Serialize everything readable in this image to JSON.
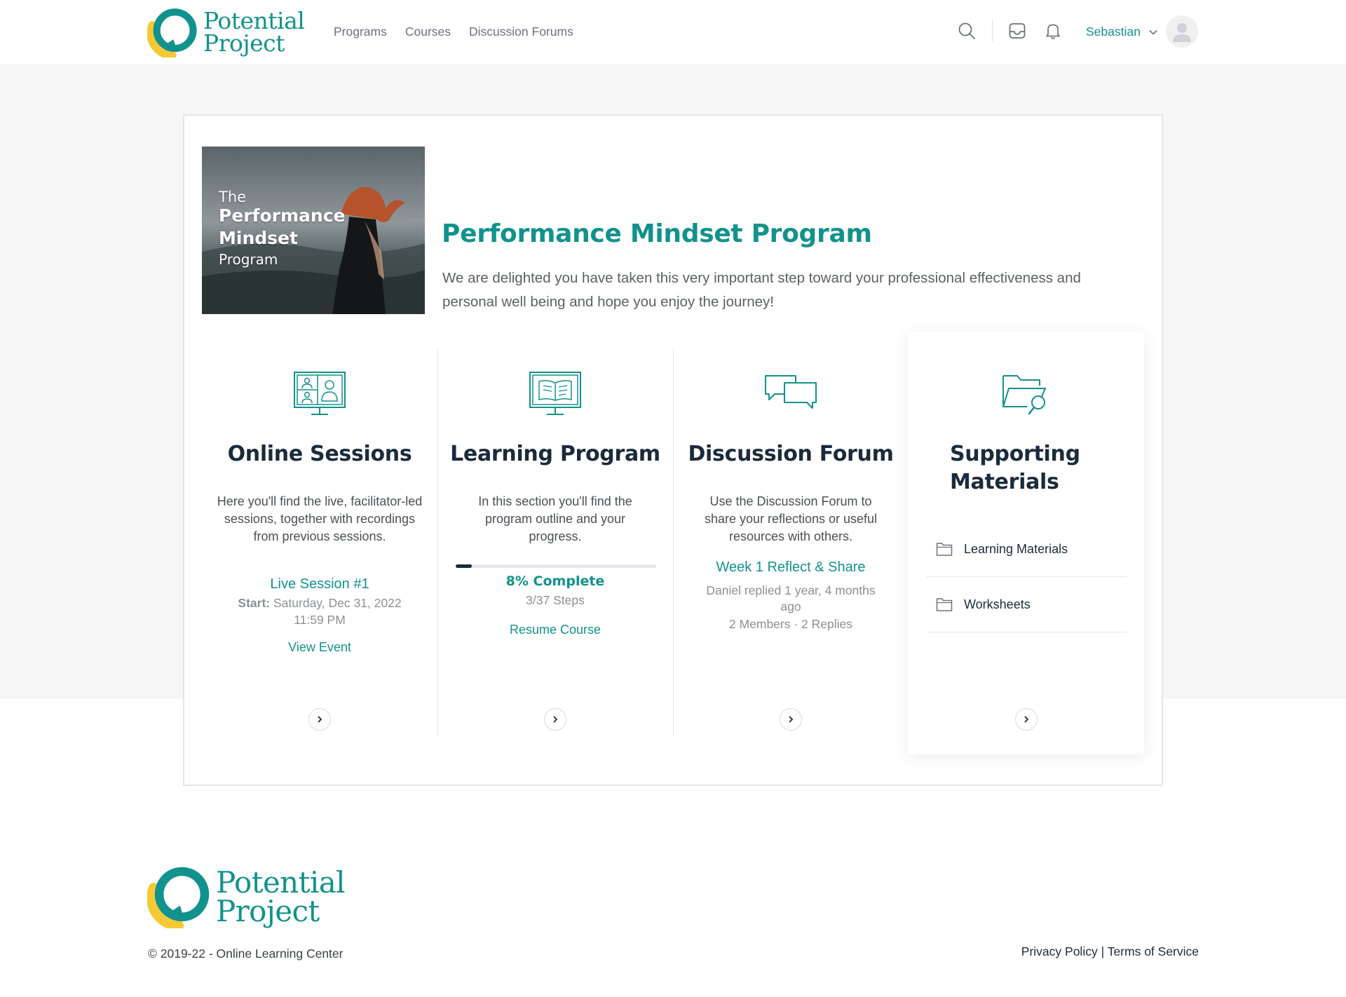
{
  "brand": {
    "line1": "Potential",
    "line2": "Project"
  },
  "nav": {
    "items": [
      "Programs",
      "Courses",
      "Discussion Forums"
    ]
  },
  "header": {
    "user_name": "Sebastian",
    "icons": [
      "search-icon",
      "inbox-icon",
      "bell-icon",
      "chevron-down-icon",
      "avatar-icon"
    ]
  },
  "hero": {
    "image_text": {
      "line1": "The",
      "line2": "Performance",
      "line3": "Mindset",
      "line4": "Program"
    },
    "title": "Performance Mindset Program",
    "description": "We are delighted you have taken this very important step toward your professional effectiveness and personal well being and hope you enjoy the journey!"
  },
  "sections": {
    "online_sessions": {
      "title": "Online Sessions",
      "description": "Here you'll find the live, facilitator-led sessions, together with recordings from previous sessions.",
      "event_title": "Live Session #1",
      "start_label": "Start:",
      "start_value": "Saturday, Dec 31, 2022 11:59 PM",
      "link": "View Event"
    },
    "learning_program": {
      "title": "Learning Program",
      "description": "In this section you'll find the program outline and your progress.",
      "progress_percent": 8,
      "progress_label": "8% Complete",
      "steps": "3/37 Steps",
      "link": "Resume Course"
    },
    "discussion_forum": {
      "title": "Discussion Forum",
      "description": "Use the Discussion Forum to share your reflections or useful resources with others.",
      "topic": "Week 1 Reflect & Share",
      "last_reply": "Daniel replied 1 year, 4 months ago",
      "stats": "2 Members · 2 Replies"
    },
    "supporting_materials": {
      "title": "Supporting Materials",
      "items": [
        "Learning Materials",
        "Worksheets"
      ]
    }
  },
  "footer": {
    "copyright": "© 2019-22 - Online Learning Center",
    "privacy": "Privacy Policy",
    "separator": "|",
    "terms": "Terms of Service"
  },
  "colors": {
    "teal": "#12928c",
    "yellow": "#f5c934",
    "navy": "#1a2b3c",
    "band": "#f6f6f7"
  }
}
